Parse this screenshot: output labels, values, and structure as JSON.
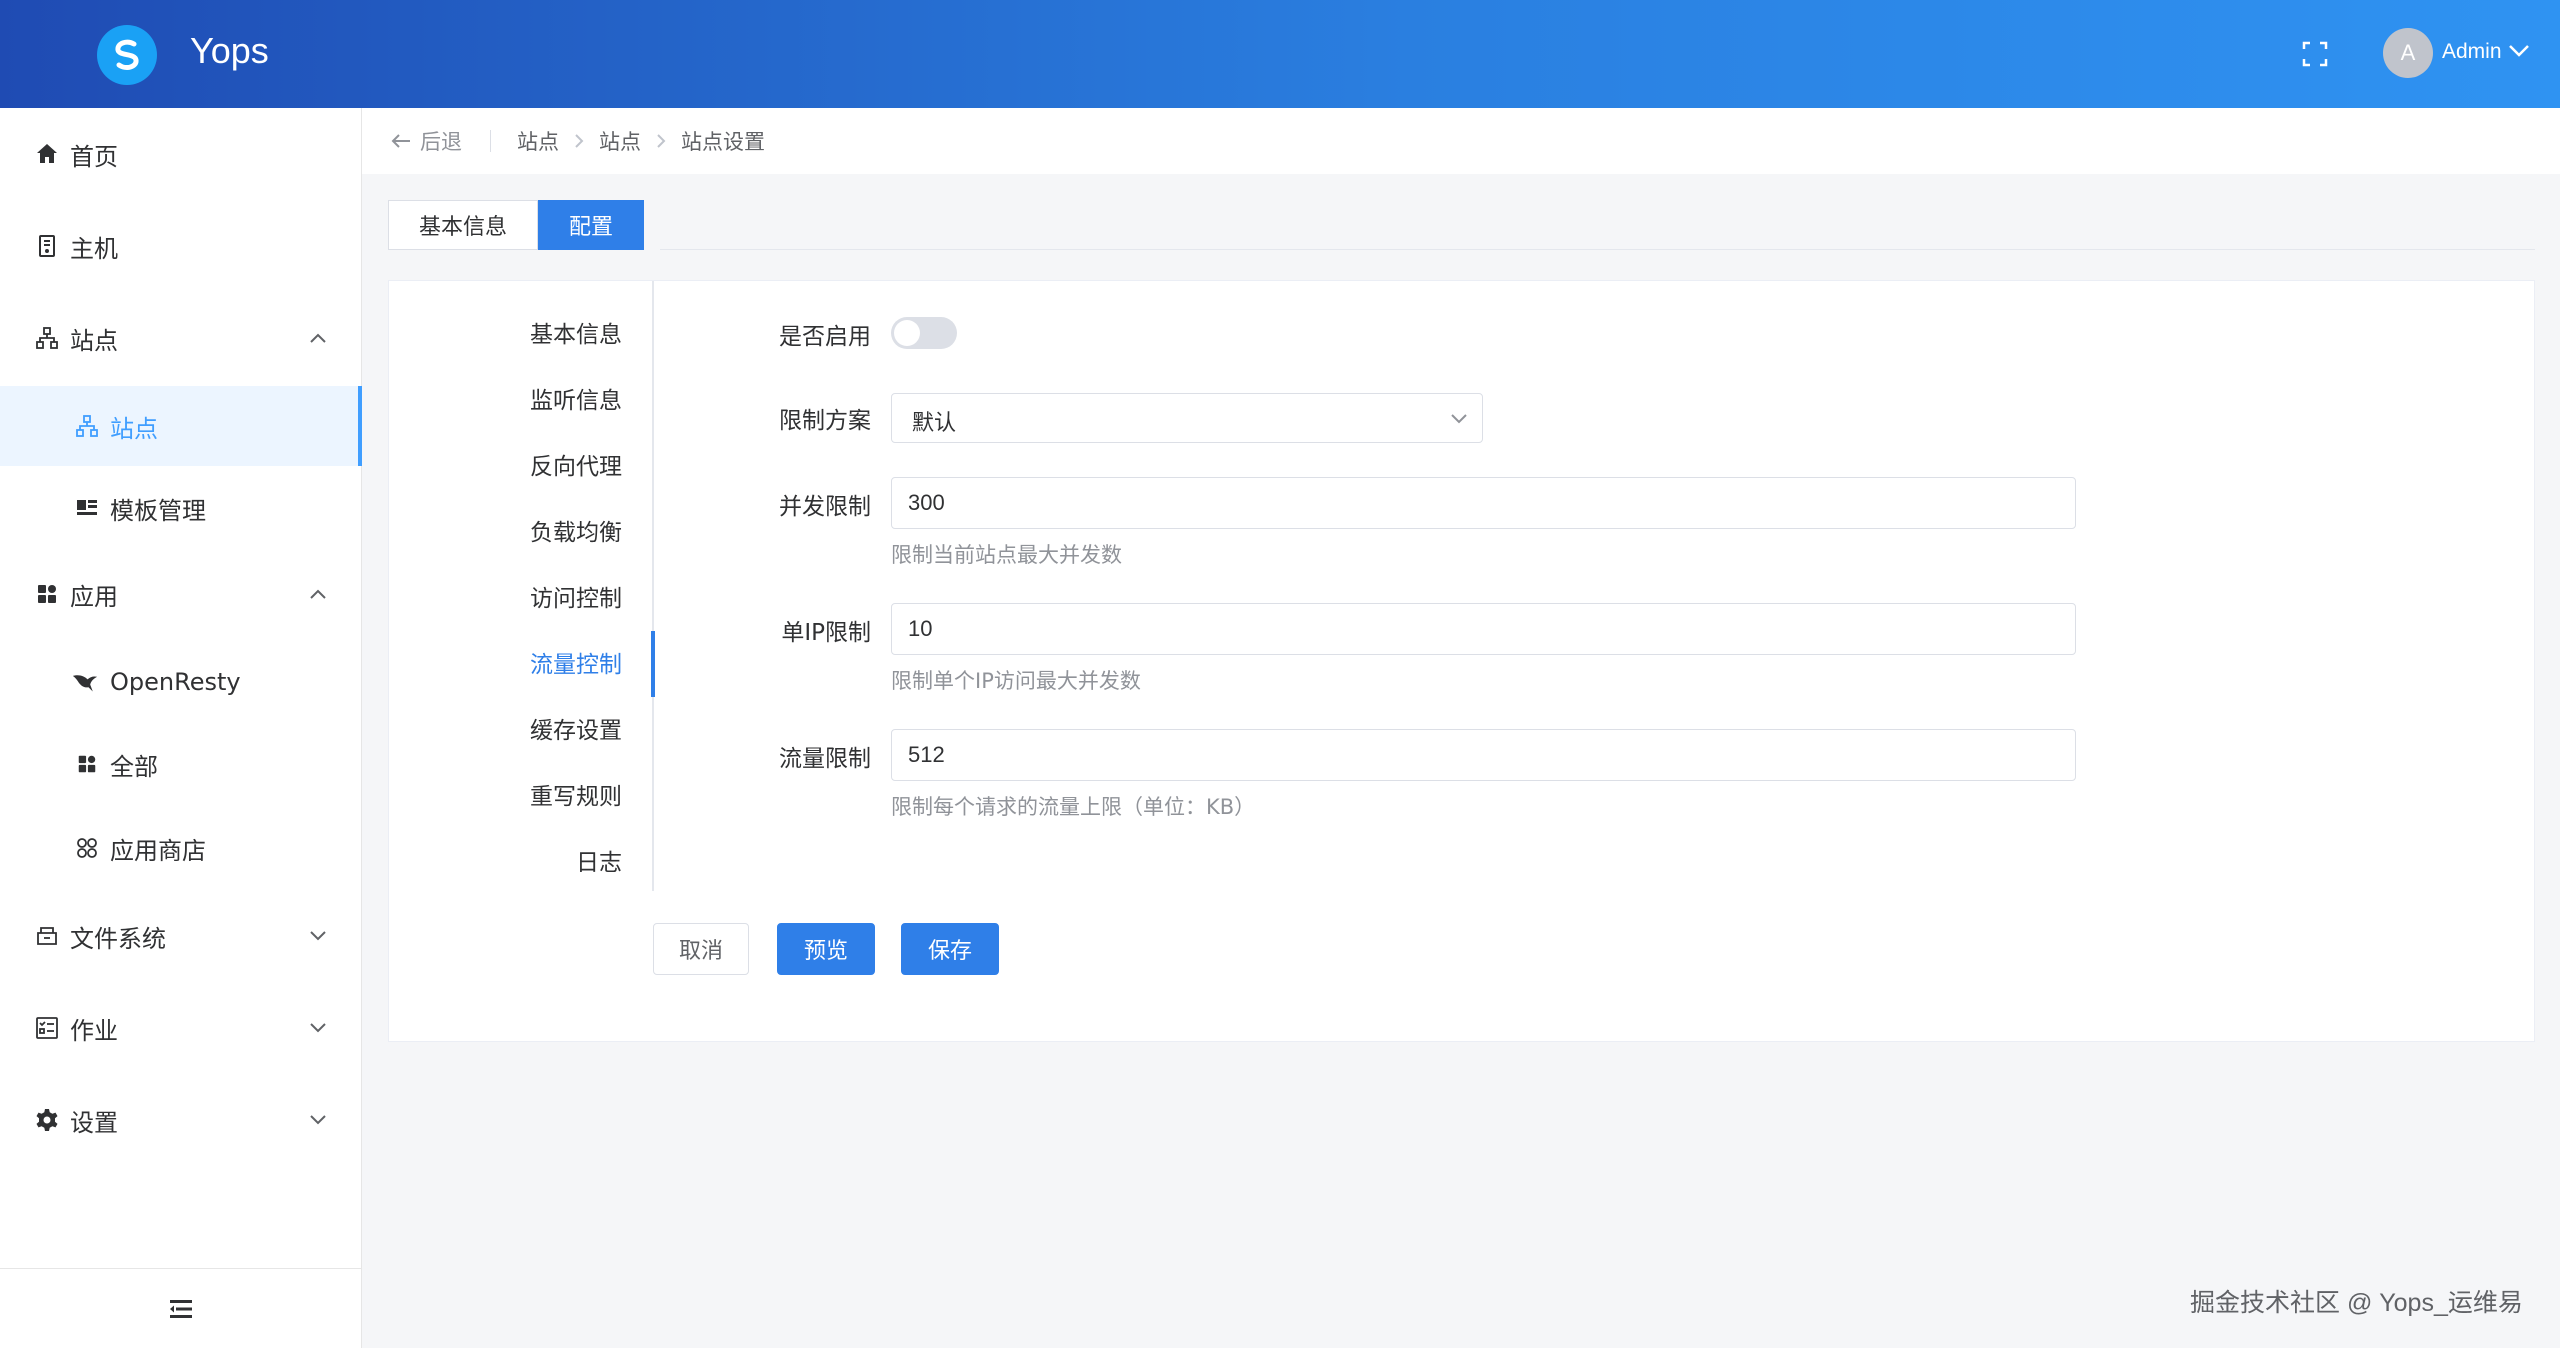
{
  "header": {
    "app_title": "Yops",
    "avatar_letter": "A",
    "user_name": "Admin"
  },
  "sidebar": {
    "items": [
      {
        "label": "首页",
        "icon": "home-icon"
      },
      {
        "label": "主机",
        "icon": "server-icon"
      },
      {
        "label": "站点",
        "icon": "sitemap-icon",
        "expanded": true
      },
      {
        "label": "站点",
        "icon": "sitemap-icon",
        "active": true
      },
      {
        "label": "模板管理",
        "icon": "template-icon"
      },
      {
        "label": "应用",
        "icon": "apps-icon",
        "expanded": true
      },
      {
        "label": "OpenResty",
        "icon": "openresty-icon"
      },
      {
        "label": "全部",
        "icon": "grid-icon"
      },
      {
        "label": "应用商店",
        "icon": "store-icon"
      },
      {
        "label": "文件系统",
        "icon": "folder-icon",
        "expanded": false
      },
      {
        "label": "作业",
        "icon": "task-icon",
        "expanded": false
      },
      {
        "label": "设置",
        "icon": "gear-icon",
        "expanded": false
      }
    ]
  },
  "breadcrumb": {
    "back_label": "后退",
    "items": [
      "站点",
      "站点",
      "站点设置"
    ]
  },
  "tabs": [
    {
      "label": "基本信息",
      "active": false
    },
    {
      "label": "配置",
      "active": true
    }
  ],
  "sub_nav": {
    "items": [
      "基本信息",
      "监听信息",
      "反向代理",
      "负载均衡",
      "访问控制",
      "流量控制",
      "缓存设置",
      "重写规则",
      "日志"
    ],
    "active_index": 5
  },
  "form": {
    "enable_label": "是否启用",
    "enabled": false,
    "plan_label": "限制方案",
    "plan_value": "默认",
    "concurrency_label": "并发限制",
    "concurrency_value": "300",
    "concurrency_hint": "限制当前站点最大并发数",
    "per_ip_label": "单IP限制",
    "per_ip_value": "10",
    "per_ip_hint": "限制单个IP访问最大并发数",
    "rate_label": "流量限制",
    "rate_value": "512",
    "rate_hint": "限制每个请求的流量上限（单位：KB）"
  },
  "actions": {
    "cancel": "取消",
    "preview": "预览",
    "save": "保存"
  },
  "watermark": "掘金技术社区 @ Yops_运维易",
  "colors": {
    "primary": "#2f7fe8",
    "header_start": "#1f4bb3",
    "header_end": "#2f93f2"
  }
}
